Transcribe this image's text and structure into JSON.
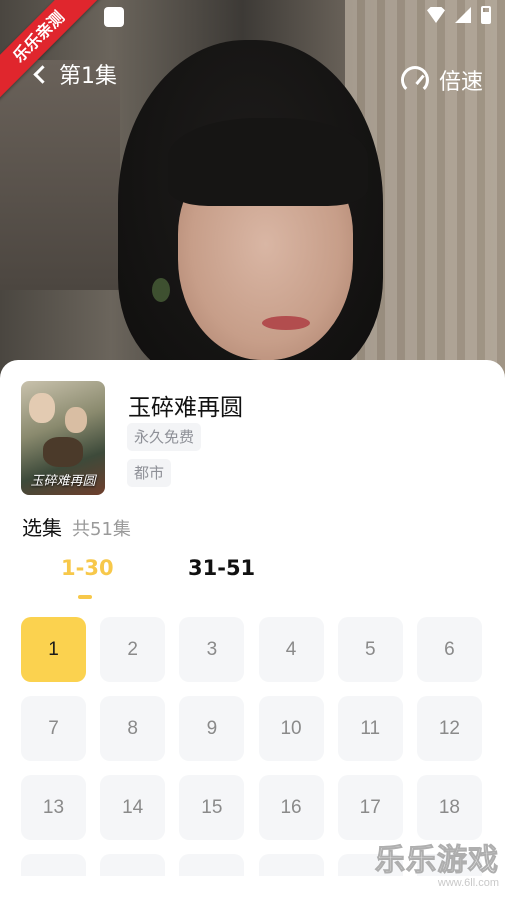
{
  "header": {
    "episode_title": "第1集",
    "speed_label": "倍速"
  },
  "ribbon": "乐乐亲测",
  "drama": {
    "poster_title": "玉碎难再圆",
    "title": "玉碎难再圆",
    "tags": [
      "永久免费",
      "都市"
    ]
  },
  "episodes": {
    "heading": "选集",
    "count": "共51集",
    "ranges": [
      "1-30",
      "31-51"
    ],
    "active_range": "1-30",
    "items": [
      "1",
      "2",
      "3",
      "4",
      "5",
      "6",
      "7",
      "8",
      "9",
      "10",
      "11",
      "12",
      "13",
      "14",
      "15",
      "16",
      "17",
      "18",
      "",
      "",
      "",
      "",
      "",
      ""
    ],
    "selected": "1"
  },
  "watermark": {
    "big": "乐乐游戏",
    "small": "www.6ll.com"
  },
  "colors": {
    "accent": "#fbd24f",
    "accent_text": "#f7c84a",
    "ribbon": "#e0262d",
    "tile_bg": "#f5f6f8"
  }
}
